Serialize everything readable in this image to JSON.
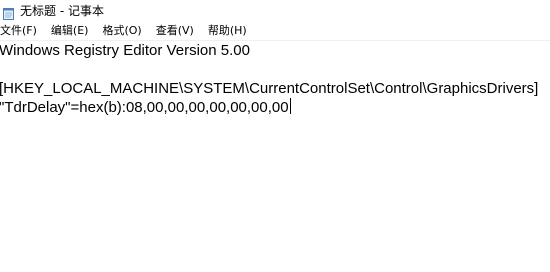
{
  "window": {
    "title": "无标题 - 记事本",
    "icon": "notepad-icon"
  },
  "menu": [
    {
      "label": "文件(F)"
    },
    {
      "label": "编辑(E)"
    },
    {
      "label": "格式(O)"
    },
    {
      "label": "查看(V)"
    },
    {
      "label": "帮助(H)"
    }
  ],
  "editor": {
    "lines": [
      "Windows Registry Editor Version 5.00",
      "",
      "[HKEY_LOCAL_MACHINE\\SYSTEM\\CurrentControlSet\\Control\\GraphicsDrivers]",
      "\"TdrDelay\"=hex(b):08,00,00,00,00,00,00,00"
    ]
  }
}
